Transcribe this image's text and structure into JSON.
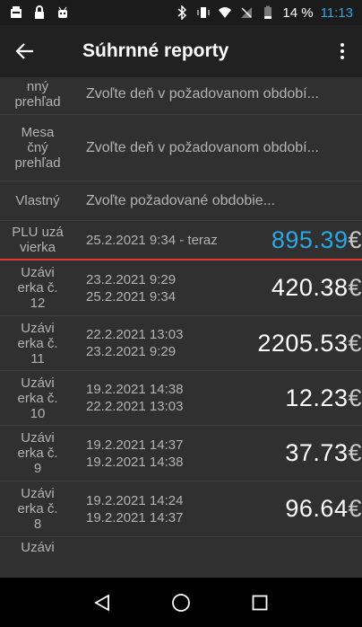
{
  "status_bar": {
    "battery": "14 %",
    "time": "11:13",
    "time_color": "#2aa7e6"
  },
  "app_bar": {
    "title": "Súhrnné reporty"
  },
  "rows": [
    {
      "label": "nný\nprehľad",
      "text": "Zvoľte deň v požadovanom období..."
    },
    {
      "label": "Mesa\nčný\nprehľad",
      "text": "Zvoľte deň v požadovanom období..."
    },
    {
      "label": "Vlastný",
      "text": "Zvoľte požadované obdobie..."
    },
    {
      "label": "PLU uzá\nvierka",
      "date_from": "25.2.2021 9:34 - teraz",
      "amount": "895.39",
      "currency": "€",
      "highlight": true
    },
    {
      "label": "Uzávi\nerka č.\n12",
      "date_from": "23.2.2021 9:29",
      "date_to": "25.2.2021 9:34",
      "amount": "420.38",
      "currency": "€"
    },
    {
      "label": "Uzávi\nerka č.\n11",
      "date_from": "22.2.2021 13:03",
      "date_to": "23.2.2021 9:29",
      "amount": "2205.53",
      "currency": "€"
    },
    {
      "label": "Uzávi\nerka č.\n10",
      "date_from": "19.2.2021 14:38",
      "date_to": "22.2.2021 13:03",
      "amount": "12.23",
      "currency": "€"
    },
    {
      "label": "Uzávi\nerka č.\n9",
      "date_from": "19.2.2021 14:37",
      "date_to": "19.2.2021 14:38",
      "amount": "37.73",
      "currency": "€"
    },
    {
      "label": "Uzávi\nerka č.\n8",
      "date_from": "19.2.2021 14:24",
      "date_to": "19.2.2021 14:37",
      "amount": "96.64",
      "currency": "€"
    },
    {
      "label": "Uzávi"
    }
  ],
  "colors": {
    "accent": "#2aa7e6",
    "divider_highlight": "#e53935"
  }
}
